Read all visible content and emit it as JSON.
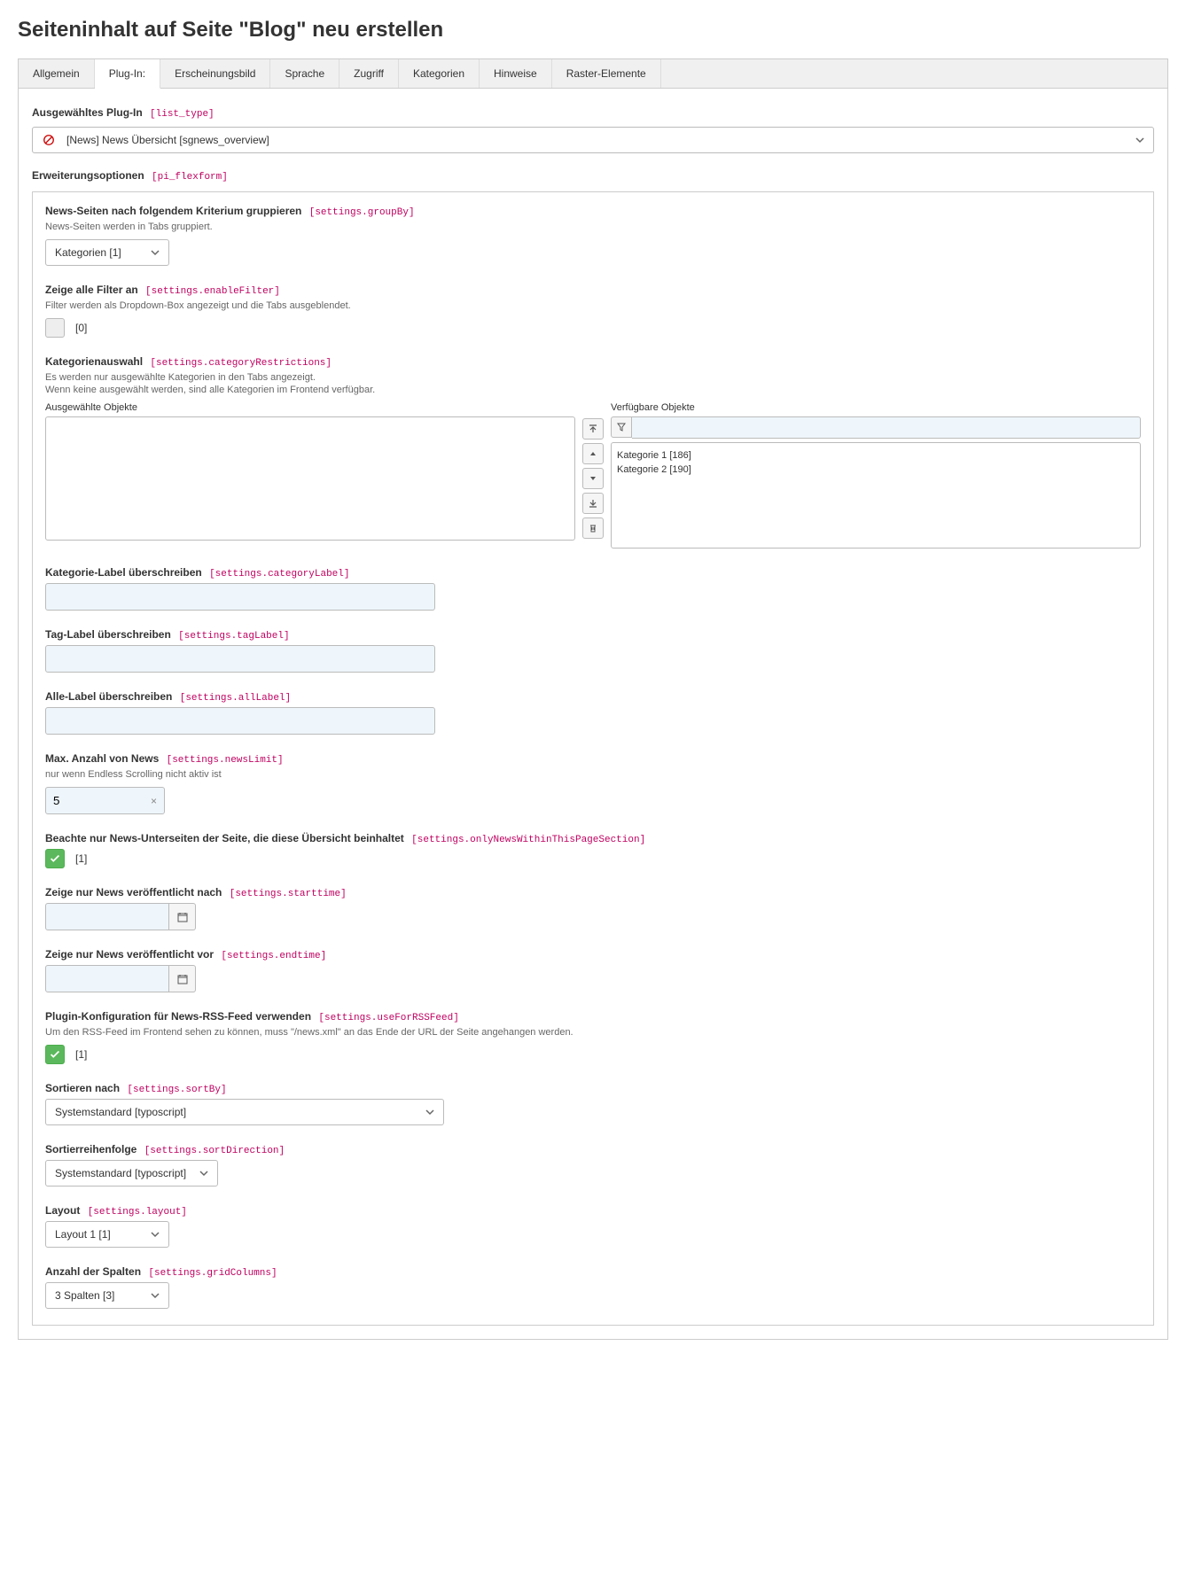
{
  "page_title": "Seiteninhalt auf Seite \"Blog\" neu erstellen",
  "tabs": [
    {
      "label": "Allgemein"
    },
    {
      "label": "Plug-In:"
    },
    {
      "label": "Erscheinungsbild"
    },
    {
      "label": "Sprache"
    },
    {
      "label": "Zugriff"
    },
    {
      "label": "Kategorien"
    },
    {
      "label": "Hinweise"
    },
    {
      "label": "Raster-Elemente"
    }
  ],
  "plugin_select": {
    "label": "Ausgewähltes Plug-In",
    "code": "[list_type]",
    "value": "[News] News Übersicht [sgnews_overview]"
  },
  "ext_options": {
    "label": "Erweiterungsoptionen",
    "code": "[pi_flexform]"
  },
  "fields": {
    "groupBy": {
      "label": "News-Seiten nach folgendem Kriterium gruppieren",
      "code": "[settings.groupBy]",
      "help": "News-Seiten werden in Tabs gruppiert.",
      "value": "Kategorien [1]"
    },
    "enableFilter": {
      "label": "Zeige alle Filter an",
      "code": "[settings.enableFilter]",
      "help": "Filter werden als Dropdown-Box angezeigt und die Tabs ausgeblendet.",
      "value": "[0]"
    },
    "categoryRestrictions": {
      "label": "Kategorienauswahl",
      "code": "[settings.categoryRestrictions]",
      "help1": "Es werden nur ausgewählte Kategorien in den Tabs angezeigt.",
      "help2": "Wenn keine ausgewählt werden, sind alle Kategorien im Frontend verfügbar.",
      "selected_label": "Ausgewählte Objekte",
      "available_label": "Verfügbare Objekte",
      "available_items": [
        "Kategorie 1 [186]",
        "Kategorie 2 [190]"
      ]
    },
    "categoryLabel": {
      "label": "Kategorie-Label überschreiben",
      "code": "[settings.categoryLabel]",
      "value": ""
    },
    "tagLabel": {
      "label": "Tag-Label überschreiben",
      "code": "[settings.tagLabel]",
      "value": ""
    },
    "allLabel": {
      "label": "Alle-Label überschreiben",
      "code": "[settings.allLabel]",
      "value": ""
    },
    "newsLimit": {
      "label": "Max. Anzahl von News",
      "code": "[settings.newsLimit]",
      "help": "nur wenn Endless Scrolling nicht aktiv ist",
      "value": "5"
    },
    "onlyNews": {
      "label": "Beachte nur News-Unterseiten der Seite, die diese Übersicht beinhaltet",
      "code": "[settings.onlyNewsWithinThisPageSection]",
      "value": "[1]"
    },
    "starttime": {
      "label": "Zeige nur News veröffentlicht nach",
      "code": "[settings.starttime]",
      "value": ""
    },
    "endtime": {
      "label": "Zeige nur News veröffentlicht vor",
      "code": "[settings.endtime]",
      "value": ""
    },
    "useForRSSFeed": {
      "label": "Plugin-Konfiguration für News-RSS-Feed verwenden",
      "code": "[settings.useForRSSFeed]",
      "help": "Um den RSS-Feed im Frontend sehen zu können, muss \"/news.xml\" an das Ende der URL der Seite angehangen werden.",
      "value": "[1]"
    },
    "sortBy": {
      "label": "Sortieren nach",
      "code": "[settings.sortBy]",
      "value": "Systemstandard [typoscript]"
    },
    "sortDirection": {
      "label": "Sortierreihenfolge",
      "code": "[settings.sortDirection]",
      "value": "Systemstandard [typoscript]"
    },
    "layout": {
      "label": "Layout",
      "code": "[settings.layout]",
      "value": "Layout 1 [1]"
    },
    "gridColumns": {
      "label": "Anzahl der Spalten",
      "code": "[settings.gridColumns]",
      "value": "3 Spalten [3]"
    }
  }
}
